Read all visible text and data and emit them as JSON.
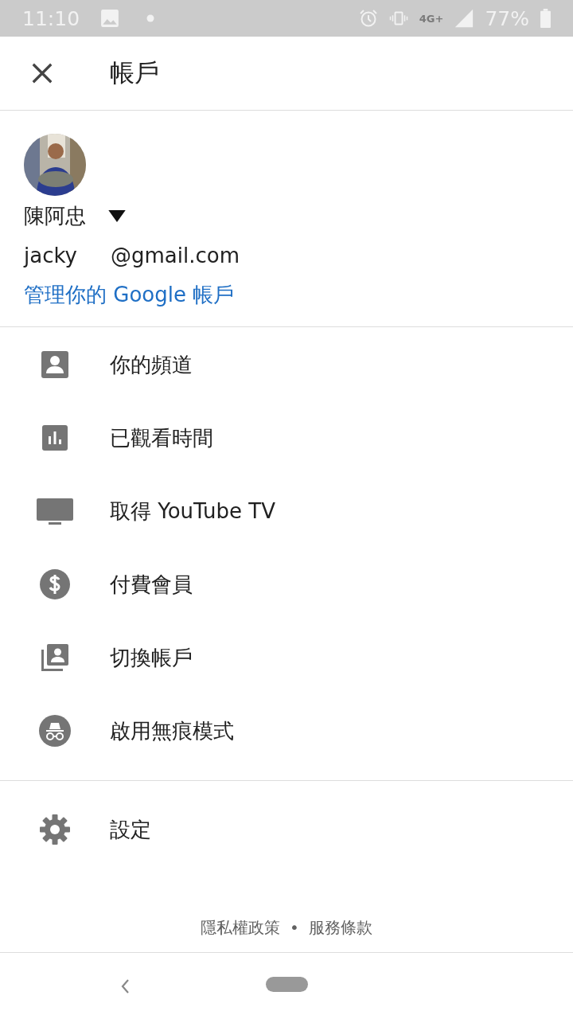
{
  "status_bar": {
    "time": "11:10",
    "network": "4G+",
    "battery": "77%"
  },
  "header": {
    "title": "帳戶"
  },
  "account": {
    "name": "陳阿忠",
    "email_user": "jacky",
    "email_domain": "@gmail.com",
    "manage_link": "管理你的 Google 帳戶"
  },
  "menu": [
    {
      "kind": "channel",
      "label": "你的頻道"
    },
    {
      "kind": "watch-time",
      "label": "已觀看時間"
    },
    {
      "kind": "tv",
      "label": "取得 YouTube TV"
    },
    {
      "kind": "paid",
      "label": "付費會員"
    },
    {
      "kind": "switch",
      "label": "切換帳戶"
    },
    {
      "kind": "incognito",
      "label": "啟用無痕模式"
    }
  ],
  "menu_2": [
    {
      "kind": "settings",
      "label": "設定"
    }
  ],
  "footer": {
    "privacy": "隱私權政策",
    "separator": "•",
    "terms": "服務條款"
  }
}
